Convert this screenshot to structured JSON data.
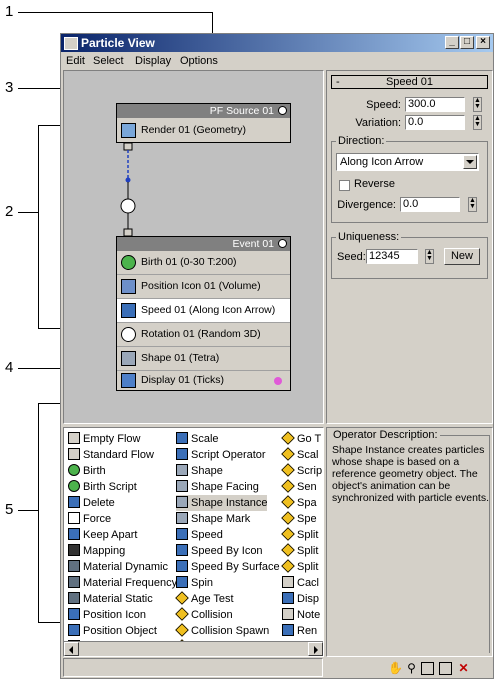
{
  "callouts": [
    "1",
    "2",
    "3",
    "4",
    "5"
  ],
  "window": {
    "title": "Particle View",
    "controls": {
      "minimize": "_",
      "maximize": "□",
      "close": "×"
    }
  },
  "menu": [
    "Edit",
    "Select",
    "Display",
    "Options"
  ],
  "graph": {
    "source": {
      "title": "PF Source 01",
      "operators": [
        {
          "label": "Render 01 (Geometry)",
          "icon": "render-icon"
        }
      ]
    },
    "event": {
      "title": "Event 01",
      "operators": [
        {
          "label": "Birth 01 (0-30 T:200)",
          "icon": "birth-icon"
        },
        {
          "label": "Position Icon 01 (Volume)",
          "icon": "position-icon"
        },
        {
          "label": "Speed 01 (Along Icon Arrow)",
          "icon": "speed-icon",
          "selected": true
        },
        {
          "label": "Rotation 01 (Random 3D)",
          "icon": "rotation-icon"
        },
        {
          "label": "Shape 01 (Tetra)",
          "icon": "shape-icon"
        },
        {
          "label": "Display 01 (Ticks)",
          "icon": "display-icon",
          "display_color": "#e05ad8"
        }
      ]
    }
  },
  "params": {
    "rollout_title": "Speed 01",
    "rollout_toggle": "-",
    "speed_label": "Speed:",
    "speed_value": "300.0",
    "variation_label": "Variation:",
    "variation_value": "0.0",
    "direction_group": "Direction:",
    "direction_value": "Along Icon Arrow",
    "reverse_label": "Reverse",
    "divergence_label": "Divergence:",
    "divergence_value": "0.0",
    "uniqueness_group": "Uniqueness:",
    "seed_label": "Seed:",
    "seed_value": "12345",
    "new_button": "New"
  },
  "depot": {
    "columns": [
      [
        "Empty Flow",
        "Standard Flow",
        "Birth",
        "Birth Script",
        "Delete",
        "Force",
        "Keep Apart",
        "Mapping",
        "Material Dynamic",
        "Material Frequency",
        "Material Static",
        "Position Icon",
        "Position Object",
        "Rotation"
      ],
      [
        "Scale",
        "Script Operator",
        "Shape",
        "Shape Facing",
        "Shape Instance",
        "Shape Mark",
        "Speed",
        "Speed By Icon",
        "Speed By Surface",
        "Spin",
        "Age Test",
        "Collision",
        "Collision Spawn",
        "Find Target"
      ],
      [
        "Go T",
        "Scal",
        "Scrip",
        "Sen",
        "Spa",
        "Spe",
        "Split",
        "Split",
        "Split",
        "Cacl",
        "Disp",
        "Note",
        "Ren",
        ""
      ]
    ],
    "selected": "Shape Instance"
  },
  "description": {
    "title": "Operator Description:",
    "text": "Shape Instance creates particles whose shape is based on a reference geometry object. The object's animation can be synchronized with particle events."
  },
  "toolbar_icons": [
    "pan-icon",
    "zoom-icon",
    "zoom-region-icon",
    "zoom-extents-icon",
    "no-zoom-icon"
  ]
}
